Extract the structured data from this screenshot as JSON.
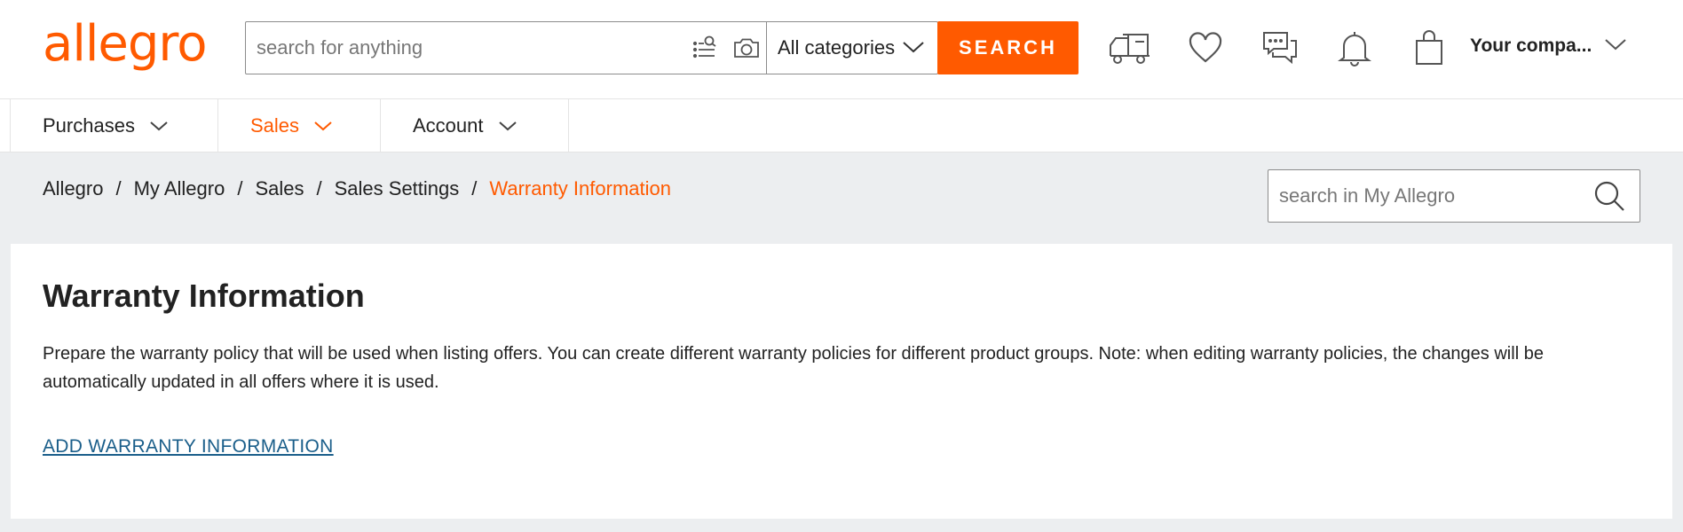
{
  "header": {
    "logo": "allegro",
    "search_placeholder": "search for anything",
    "category": "All categories",
    "search_button": "SEARCH",
    "account": "Your compa..."
  },
  "nav": {
    "tabs": [
      {
        "label": "Purchases"
      },
      {
        "label": "Sales"
      },
      {
        "label": "Account"
      }
    ]
  },
  "breadcrumb": {
    "items": [
      "Allegro",
      "My Allegro",
      "Sales",
      "Sales Settings"
    ],
    "current": "Warranty Information",
    "separator": "/"
  },
  "my_search": {
    "placeholder": "search in My Allegro"
  },
  "main": {
    "title": "Warranty Information",
    "description": "Prepare the warranty policy that will be used when listing offers. You can create different warranty policies for different product groups. Note: when editing warranty policies, the changes will be automatically updated in all offers where it is used.",
    "add_link": "ADD WARRANTY INFORMATION"
  },
  "colors": {
    "accent": "#ff5a00",
    "link": "#1a5e8a",
    "background": "#eceef0"
  },
  "icons": [
    "list-search-icon",
    "camera-icon",
    "chevron-down-icon",
    "delivery-truck-icon",
    "heart-icon",
    "chat-icon",
    "bell-icon",
    "shopping-bag-icon",
    "search-icon"
  ]
}
